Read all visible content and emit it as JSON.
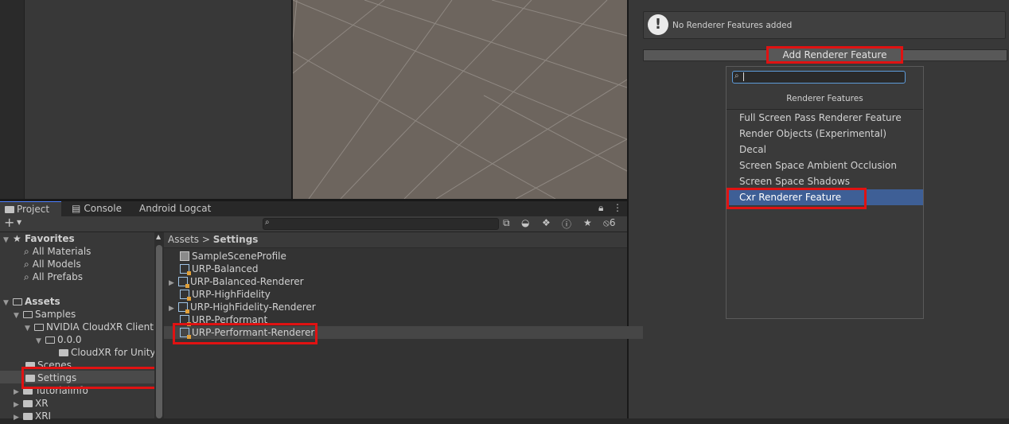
{
  "inspector": {
    "notice_icon": "!",
    "notice": "No Renderer Features added",
    "add_button": "Add Renderer Feature"
  },
  "dropdown": {
    "header": "Renderer Features",
    "items": [
      "Full Screen Pass Renderer Feature",
      "Render Objects (Experimental)",
      "Decal",
      "Screen Space Ambient Occlusion",
      "Screen Space Shadows",
      "Cxr Renderer Feature"
    ],
    "selected_index": 5
  },
  "tabs": [
    "Project",
    "Console",
    "Android Logcat"
  ],
  "toolbar": {
    "add_label": "+",
    "hidden_count": "6"
  },
  "tree": {
    "favorites": "Favorites",
    "favorite_items": [
      "All Materials",
      "All Models",
      "All Prefabs"
    ],
    "assets": "Assets",
    "samples": "Samples",
    "nvidia": "NVIDIA CloudXR Client",
    "version": "0.0.0",
    "cloudxr_unity": "CloudXR for Unity",
    "scenes": "Scenes",
    "settings": "Settings",
    "tutorialinfo": "TutorialInfo",
    "xr": "XR",
    "xri": "XRI"
  },
  "breadcrumb": {
    "root": "Assets",
    "separator": ">",
    "current": "Settings"
  },
  "files": [
    "SampleSceneProfile",
    "URP-Balanced",
    "URP-Balanced-Renderer",
    "URP-HighFidelity",
    "URP-HighFidelity-Renderer",
    "URP-Performant",
    "URP-Performant-Renderer"
  ],
  "colors": {
    "highlight": "#e01212",
    "selection": "#3e5f96",
    "active_tab_accent": "#4c7fff"
  }
}
